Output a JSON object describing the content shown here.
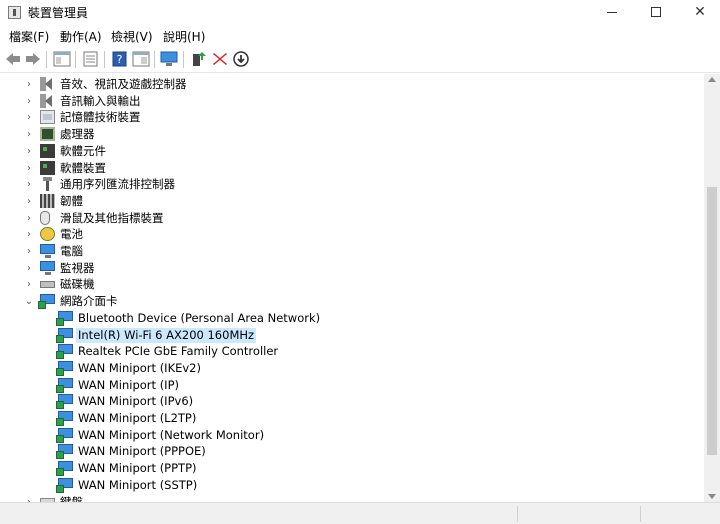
{
  "window": {
    "title": "裝置管理員"
  },
  "menu": [
    "檔案(F)",
    "動作(A)",
    "檢視(V)",
    "說明(H)"
  ],
  "toolbar": {
    "buttons": [
      "back-arrow-icon",
      "forward-arrow-icon",
      "show-hide-tree-icon",
      "properties-icon",
      "help-icon",
      "view-icon",
      "monitor-scan-icon",
      "update-driver-icon",
      "uninstall-x-icon",
      "disable-down-arrow-icon"
    ]
  },
  "tree": {
    "categories": [
      {
        "label": "音效、視訊及遊戲控制器",
        "icon": "speaker-icon",
        "expanded": false
      },
      {
        "label": "音訊輸入與輸出",
        "icon": "speaker-icon",
        "expanded": false
      },
      {
        "label": "記憶體技術裝置",
        "icon": "memory-icon",
        "expanded": false
      },
      {
        "label": "處理器",
        "icon": "processor-icon",
        "expanded": false
      },
      {
        "label": "軟體元件",
        "icon": "software-component-icon",
        "expanded": false
      },
      {
        "label": "軟體裝置",
        "icon": "software-device-icon",
        "expanded": false
      },
      {
        "label": "通用序列匯流排控制器",
        "icon": "usb-icon",
        "expanded": false
      },
      {
        "label": "韌體",
        "icon": "firmware-icon",
        "expanded": false
      },
      {
        "label": "滑鼠及其他指標裝置",
        "icon": "mouse-icon",
        "expanded": false
      },
      {
        "label": "電池",
        "icon": "battery-icon",
        "expanded": false
      },
      {
        "label": "電腦",
        "icon": "computer-icon",
        "expanded": false
      },
      {
        "label": "監視器",
        "icon": "monitor-icon",
        "expanded": false
      },
      {
        "label": "磁碟機",
        "icon": "disk-icon",
        "expanded": false
      },
      {
        "label": "網路介面卡",
        "icon": "network-adapter-icon",
        "expanded": true
      }
    ],
    "network_children": [
      "Bluetooth Device (Personal Area Network)",
      "Intel(R) Wi-Fi 6 AX200 160MHz",
      "Realtek PCIe GbE Family Controller",
      "WAN Miniport (IKEv2)",
      "WAN Miniport (IP)",
      "WAN Miniport (IPv6)",
      "WAN Miniport (L2TP)",
      "WAN Miniport (Network Monitor)",
      "WAN Miniport (PPPOE)",
      "WAN Miniport (PPTP)",
      "WAN Miniport (SSTP)"
    ],
    "selected_child": "Intel(R) Wi-Fi 6 AX200 160MHz",
    "last_category": {
      "label": "鍵盤",
      "icon": "keyboard-icon",
      "expanded": false
    }
  }
}
